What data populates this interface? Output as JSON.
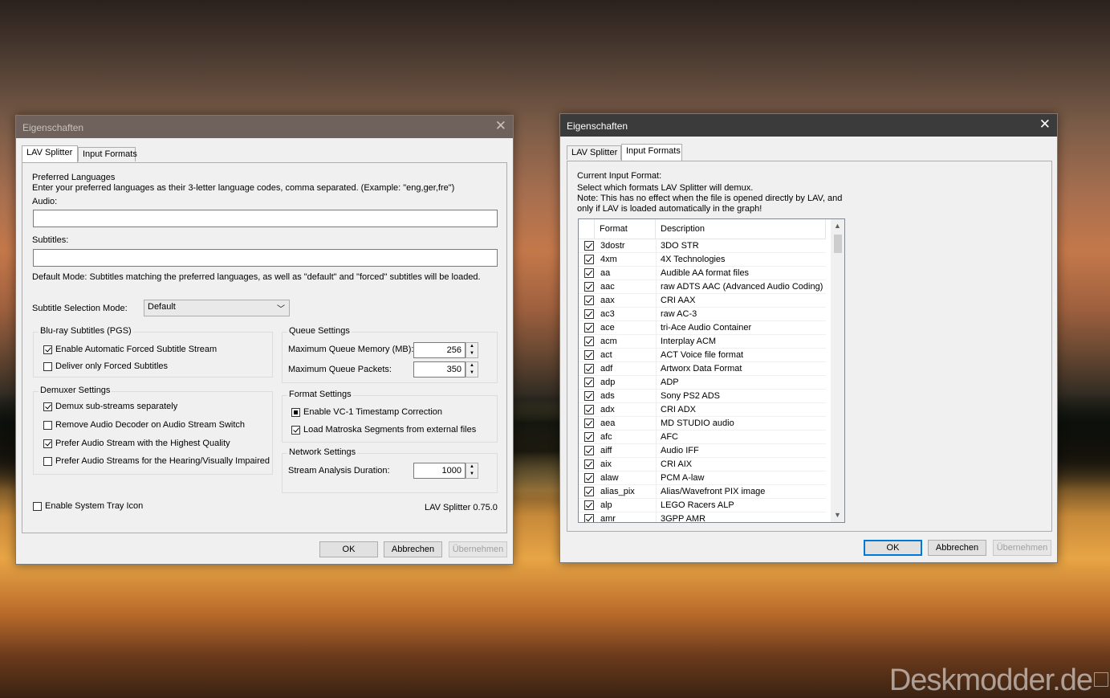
{
  "watermark": "Deskmodder.de",
  "dialog1": {
    "title": "Eigenschaften",
    "close": "✕",
    "tabs": [
      "LAV Splitter",
      "Input Formats"
    ],
    "preferred_languages": "Preferred Languages",
    "pl_desc": "Enter your preferred languages as their 3-letter language codes, comma separated. (Example: \"eng,ger,fre\")",
    "audio_label": "Audio:",
    "audio_value": "",
    "subtitles_label": "Subtitles:",
    "subtitles_value": "",
    "default_mode": "Default Mode: Subtitles matching the preferred languages, as well as \"default\" and \"forced\" subtitles will be loaded.",
    "subtitle_mode_label": "Subtitle Selection Mode:",
    "subtitle_mode_value": "Default",
    "bluray_group": "Blu-ray Subtitles (PGS)",
    "bluray_items": [
      {
        "label": "Enable Automatic Forced Subtitle Stream",
        "checked": true
      },
      {
        "label": "Deliver only Forced Subtitles",
        "checked": false
      }
    ],
    "demuxer_group": "Demuxer Settings",
    "demuxer_items": [
      {
        "label": "Demux sub-streams separately",
        "checked": true
      },
      {
        "label": "Remove Audio Decoder on Audio Stream Switch",
        "checked": false
      },
      {
        "label": "Prefer Audio Stream with the Highest Quality",
        "checked": true
      },
      {
        "label": "Prefer Audio Streams for the Hearing/Visually Impaired",
        "checked": false
      }
    ],
    "queue_group": "Queue Settings",
    "queue_memory_label": "Maximum Queue Memory (MB):",
    "queue_memory_value": "256",
    "queue_packets_label": "Maximum Queue Packets:",
    "queue_packets_value": "350",
    "format_group": "Format Settings",
    "format_items": [
      {
        "label": "Enable VC-1 Timestamp Correction",
        "state": "indeterminate"
      },
      {
        "label": "Load Matroska Segments from external files",
        "state": "checked"
      }
    ],
    "network_group": "Network Settings",
    "stream_analysis_label": "Stream Analysis Duration:",
    "stream_analysis_value": "1000",
    "tray_label": "Enable System Tray Icon",
    "tray_checked": false,
    "version": "LAV Splitter 0.75.0",
    "buttons": {
      "ok": "OK",
      "cancel": "Abbrechen",
      "apply": "Übernehmen"
    }
  },
  "dialog2": {
    "title": "Eigenschaften",
    "close": "✕",
    "tabs": [
      "LAV Splitter",
      "Input Formats"
    ],
    "current_input": "Current Input Format:",
    "select_text": "Select which formats LAV Splitter will demux.",
    "note1": "Note: This has no effect when the file is opened directly by LAV, and",
    "note2": "only if LAV is loaded automatically in the graph!",
    "col_format": "Format",
    "col_description": "Description",
    "rows": [
      {
        "format": "3dostr",
        "description": "3DO STR"
      },
      {
        "format": "4xm",
        "description": "4X Technologies"
      },
      {
        "format": "aa",
        "description": "Audible AA format files"
      },
      {
        "format": "aac",
        "description": "raw ADTS AAC (Advanced Audio Coding)"
      },
      {
        "format": "aax",
        "description": "CRI AAX"
      },
      {
        "format": "ac3",
        "description": "raw AC-3"
      },
      {
        "format": "ace",
        "description": "tri-Ace Audio Container"
      },
      {
        "format": "acm",
        "description": "Interplay ACM"
      },
      {
        "format": "act",
        "description": "ACT Voice file format"
      },
      {
        "format": "adf",
        "description": "Artworx Data Format"
      },
      {
        "format": "adp",
        "description": "ADP"
      },
      {
        "format": "ads",
        "description": "Sony PS2 ADS"
      },
      {
        "format": "adx",
        "description": "CRI ADX"
      },
      {
        "format": "aea",
        "description": "MD STUDIO audio"
      },
      {
        "format": "afc",
        "description": "AFC"
      },
      {
        "format": "aiff",
        "description": "Audio IFF"
      },
      {
        "format": "aix",
        "description": "CRI AIX"
      },
      {
        "format": "alaw",
        "description": "PCM A-law"
      },
      {
        "format": "alias_pix",
        "description": "Alias/Wavefront PIX image"
      },
      {
        "format": "alp",
        "description": "LEGO Racers ALP"
      },
      {
        "format": "amr",
        "description": "3GPP AMR"
      }
    ],
    "buttons": {
      "ok": "OK",
      "cancel": "Abbrechen",
      "apply": "Übernehmen"
    }
  }
}
